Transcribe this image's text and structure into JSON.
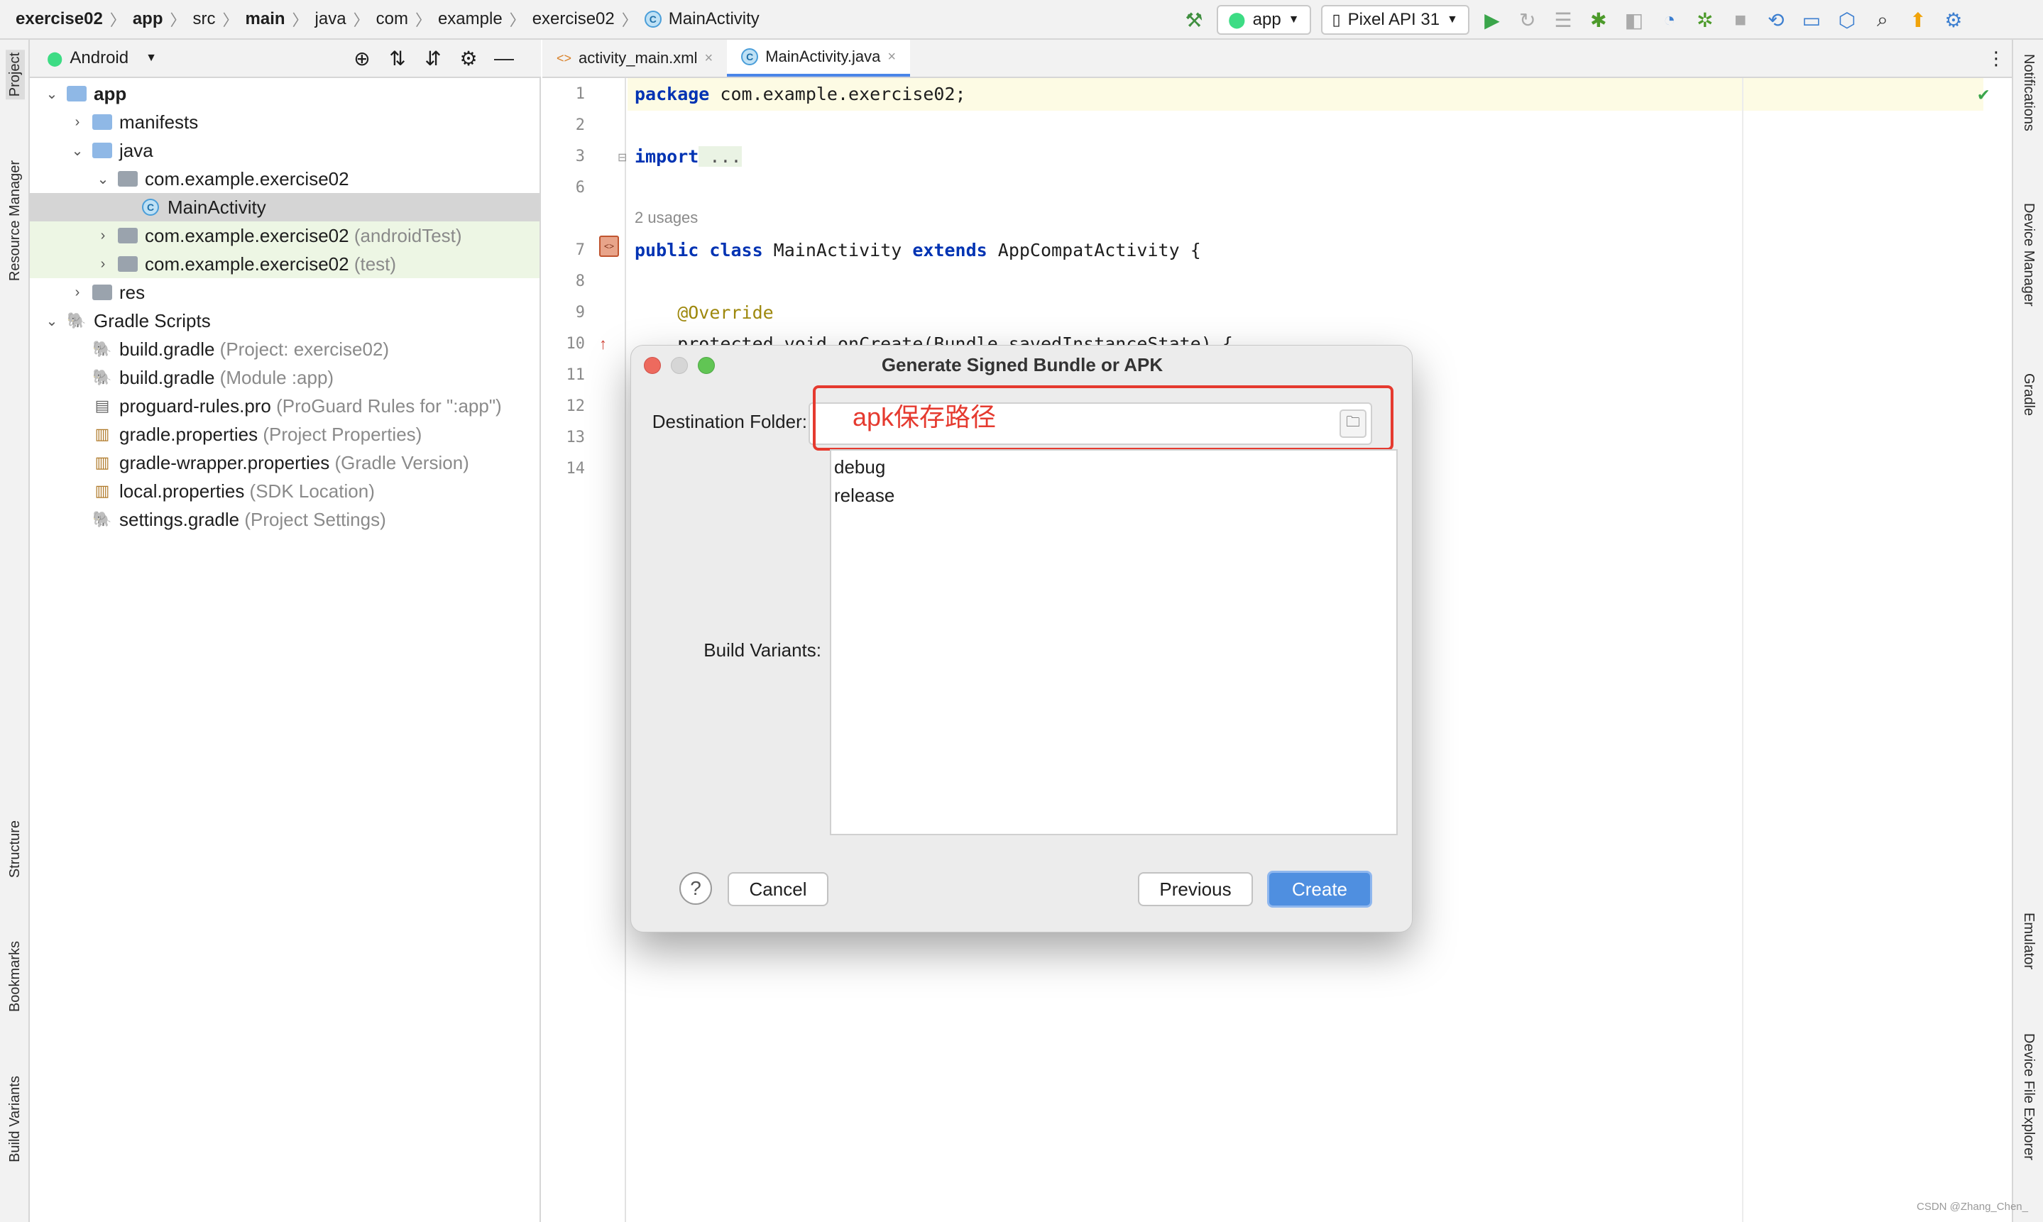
{
  "breadcrumb": {
    "items": [
      "exercise02",
      "app",
      "src",
      "main",
      "java",
      "com",
      "example",
      "exercise02",
      "MainActivity"
    ]
  },
  "toolbar": {
    "run_config": "app",
    "device": "Pixel API 31"
  },
  "left_tools": [
    "Project",
    "Resource Manager",
    "Structure",
    "Bookmarks",
    "Build Variants"
  ],
  "right_tools": [
    "Notifications",
    "Device Manager",
    "Gradle",
    "Emulator",
    "Device File Explorer"
  ],
  "project_panel": {
    "view_mode": "Android",
    "tree": [
      {
        "label": "app",
        "hint": ""
      },
      {
        "label": "manifests",
        "hint": ""
      },
      {
        "label": "java",
        "hint": ""
      },
      {
        "label": "com.example.exercise02",
        "hint": ""
      },
      {
        "label": "MainActivity",
        "hint": ""
      },
      {
        "label": "com.example.exercise02",
        "hint": "(androidTest)"
      },
      {
        "label": "com.example.exercise02",
        "hint": "(test)"
      },
      {
        "label": "res",
        "hint": ""
      },
      {
        "label": "Gradle Scripts",
        "hint": ""
      },
      {
        "label": "build.gradle",
        "hint": "(Project: exercise02)"
      },
      {
        "label": "build.gradle",
        "hint": "(Module :app)"
      },
      {
        "label": "proguard-rules.pro",
        "hint": "(ProGuard Rules for \":app\")"
      },
      {
        "label": "gradle.properties",
        "hint": "(Project Properties)"
      },
      {
        "label": "gradle-wrapper.properties",
        "hint": "(Gradle Version)"
      },
      {
        "label": "local.properties",
        "hint": "(SDK Location)"
      },
      {
        "label": "settings.gradle",
        "hint": "(Project Settings)"
      }
    ]
  },
  "editor": {
    "tabs": [
      {
        "label": "activity_main.xml"
      },
      {
        "label": "MainActivity.java"
      }
    ],
    "line_numbers": [
      "1",
      "2",
      "3",
      "6",
      "7",
      "8",
      "9",
      "10",
      "11",
      "12",
      "13",
      "14"
    ],
    "code": {
      "pkg_kw": "package",
      "pkg_name": " com.example.exercise02;",
      "import_kw": "import",
      "import_fold": " ...",
      "usages": "2 usages",
      "public_kw": "public",
      "class_kw": " class",
      "class_name": " MainActivity",
      "extends_kw": " extends",
      "super_name": " AppCompatActivity {",
      "override": "    @Override",
      "oncreate": "    protected void onCreate(Bundle savedInstanceState) {"
    }
  },
  "dialog": {
    "title": "Generate Signed Bundle or APK",
    "destination_label": "Destination Folder:",
    "annotation": "apk保存路径",
    "build_variants_label": "Build Variants:",
    "variants": [
      "debug",
      "release"
    ],
    "help_label": "?",
    "cancel_label": "Cancel",
    "previous_label": "Previous",
    "create_label": "Create"
  },
  "watermark": "CSDN @Zhang_Chen_"
}
